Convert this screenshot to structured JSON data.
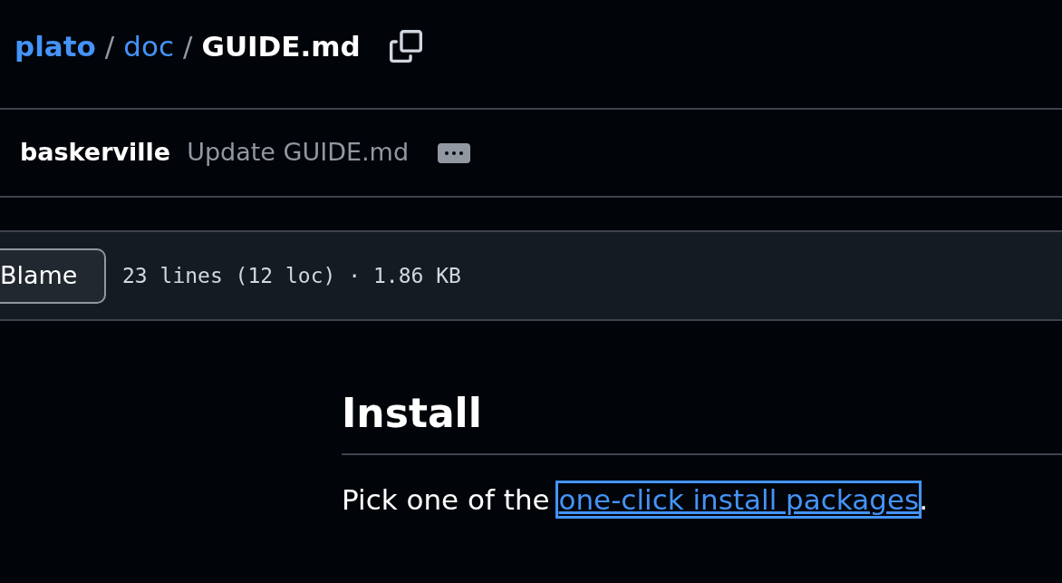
{
  "breadcrumb": [
    {
      "label": "plato",
      "kind": "repo"
    },
    {
      "separator": "/",
      "label": "doc",
      "kind": "folder"
    },
    {
      "separator": "/",
      "label": "GUIDE.md",
      "kind": "file"
    }
  ],
  "commit": {
    "author": "baskerville",
    "message": "Update GUIDE.md"
  },
  "toolbar": {
    "button": "Blame",
    "info": "23 lines (12 loc) · 1.86 KB"
  },
  "content": {
    "heading": "Install",
    "paragraph": {
      "before": "Pick one of the ",
      "link": "one-click install packages",
      "after": ".",
      "link_focused": true
    }
  }
}
